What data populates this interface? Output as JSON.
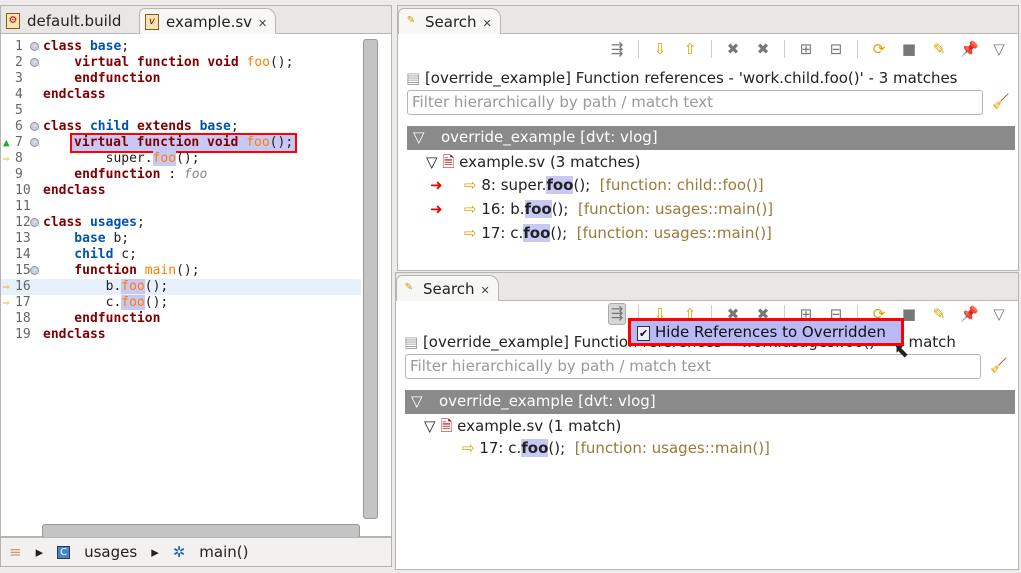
{
  "editor": {
    "tabs": [
      {
        "label": "default.build"
      },
      {
        "label": "example.sv"
      }
    ],
    "lines": [
      [
        [
          "class ",
          "kw"
        ],
        [
          "base",
          "ty"
        ],
        [
          ";",
          ""
        ]
      ],
      [
        [
          "    virtual function void ",
          "kw"
        ],
        [
          "foo",
          "fn"
        ],
        [
          "();",
          ""
        ]
      ],
      [
        [
          "    endfunction",
          "kw"
        ]
      ],
      [
        [
          "endclass",
          "kw"
        ]
      ],
      [],
      [
        [
          "class ",
          "kw"
        ],
        [
          "child ",
          "ty"
        ],
        [
          "extends ",
          "kw"
        ],
        [
          "base",
          "ty"
        ],
        [
          ";",
          ""
        ]
      ],
      [
        [
          "    virtual function void ",
          "kw"
        ],
        [
          "foo",
          "fn"
        ],
        [
          "();",
          ""
        ]
      ],
      [
        [
          "        super.",
          ""
        ],
        [
          "foo",
          "fn hl"
        ],
        [
          "();",
          ""
        ]
      ],
      [
        [
          "    endfunction ",
          "kw"
        ],
        [
          ": ",
          ""
        ],
        [
          "foo",
          "cm"
        ]
      ],
      [
        [
          "endclass",
          "kw"
        ]
      ],
      [],
      [
        [
          "class ",
          "kw"
        ],
        [
          "usages",
          "ty"
        ],
        [
          ";",
          ""
        ]
      ],
      [
        [
          "    base ",
          "ty"
        ],
        [
          "b;",
          ""
        ]
      ],
      [
        [
          "    child ",
          "ty"
        ],
        [
          "c;",
          ""
        ]
      ],
      [
        [
          "    function ",
          "kw"
        ],
        [
          "main",
          "fn"
        ],
        [
          "();",
          ""
        ]
      ],
      [
        [
          "        b.",
          ""
        ],
        [
          "foo",
          "fn hl"
        ],
        [
          "();",
          ""
        ]
      ],
      [
        [
          "        c.",
          ""
        ],
        [
          "foo",
          "fn hl"
        ],
        [
          "();",
          ""
        ]
      ],
      [
        [
          "    endfunction",
          "kw"
        ]
      ],
      [
        [
          "endclass",
          "kw"
        ]
      ]
    ],
    "breadcrumb": [
      "usages",
      "main()"
    ]
  },
  "search_top": {
    "tab": "Search",
    "title": "[override_example] Function references - 'work.child.foo()' - 3 matches",
    "filter_placeholder": "Filter hierarchically by path / match text",
    "project": "override_example [dvt: vlog]",
    "file": "example.sv (3 matches)",
    "matches": [
      {
        "pre": "8: super.",
        "m": "foo",
        "post": "();",
        "meta": "[function: child::foo()]",
        "override": true
      },
      {
        "pre": "16: b.",
        "m": "foo",
        "post": "();",
        "meta": "[function: usages::main()]",
        "override": true
      },
      {
        "pre": "17: c.",
        "m": "foo",
        "post": "();",
        "meta": "[function: usages::main()]",
        "override": false
      }
    ]
  },
  "search_bottom": {
    "tab": "Search",
    "title": "[override_example] Function references - 'work.usages.foo()' - 1 match",
    "filter_placeholder": "Filter hierarchically by path / match text",
    "project": "override_example [dvt: vlog]",
    "file": "example.sv (1 match)",
    "matches": [
      {
        "pre": "17: c.",
        "m": "foo",
        "post": "();",
        "meta": "[function: usages::main()]"
      }
    ],
    "popup": {
      "label": "Hide References to Overridden",
      "checked": true
    }
  }
}
